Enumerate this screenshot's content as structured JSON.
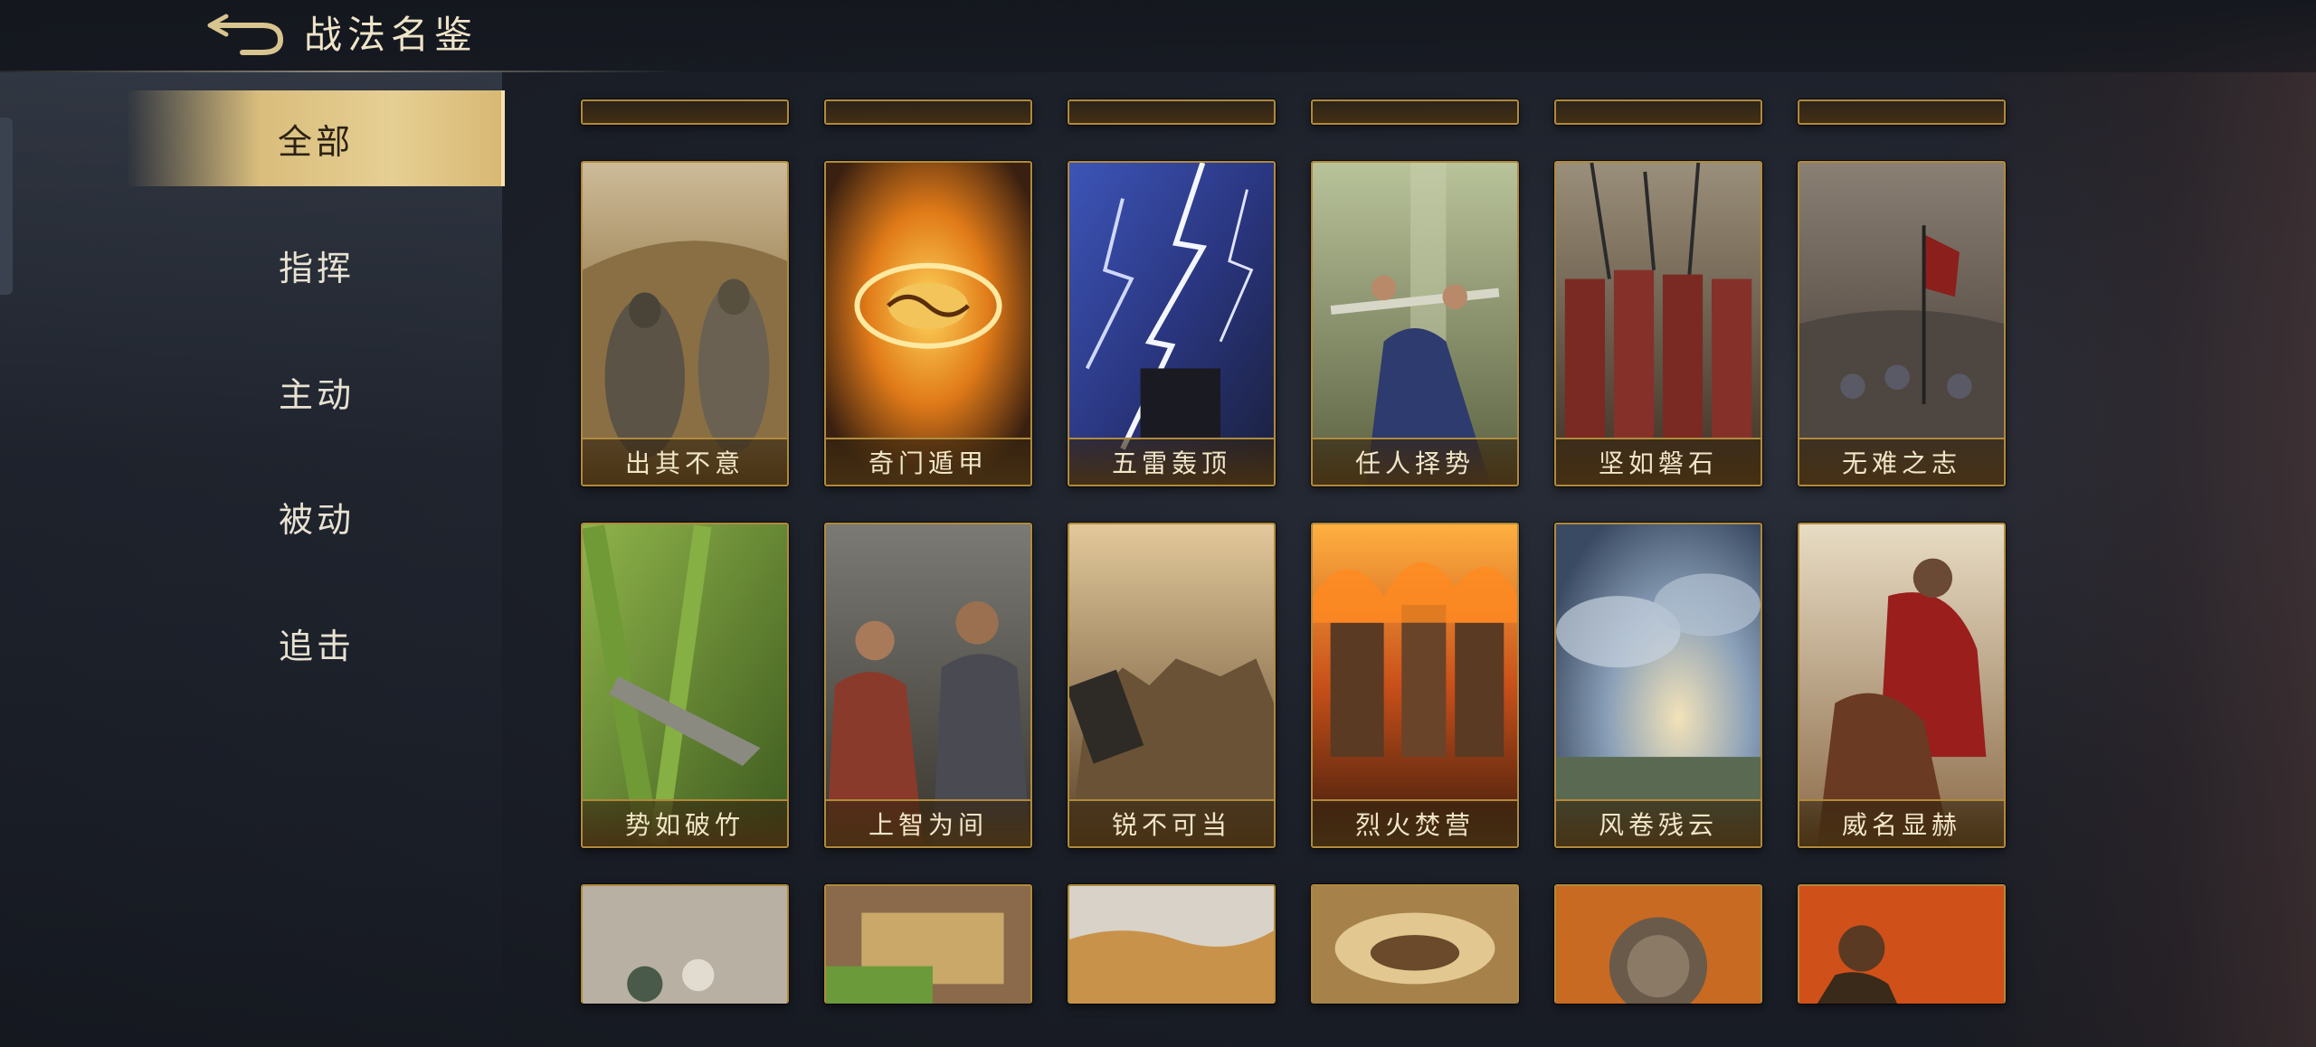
{
  "header": {
    "title": "战法名鉴"
  },
  "sidebar": {
    "items": [
      {
        "label": "全部",
        "active": true
      },
      {
        "label": "指挥",
        "active": false
      },
      {
        "label": "主动",
        "active": false
      },
      {
        "label": "被动",
        "active": false
      },
      {
        "label": "追击",
        "active": false
      }
    ]
  },
  "grid": {
    "row1": [
      {
        "label": "出其不意",
        "art": "stone-warriors"
      },
      {
        "label": "奇门遁甲",
        "art": "yin-yang-fire"
      },
      {
        "label": "五雷轰顶",
        "art": "lightning"
      },
      {
        "label": "任人择势",
        "art": "scholar-sword"
      },
      {
        "label": "坚如磐石",
        "art": "shield-wall"
      },
      {
        "label": "无难之志",
        "art": "army-march"
      }
    ],
    "row2": [
      {
        "label": "势如破竹",
        "art": "bamboo-blade"
      },
      {
        "label": "上智为间",
        "art": "two-officers"
      },
      {
        "label": "锐不可当",
        "art": "cavalry-charge"
      },
      {
        "label": "烈火焚营",
        "art": "burning-fort"
      },
      {
        "label": "风卷残云",
        "art": "storm-clouds"
      },
      {
        "label": "威名显赫",
        "art": "general-on-horse"
      }
    ]
  },
  "colors": {
    "gold": "#b08a3c",
    "active_tab": "#d9bd7c",
    "text": "#e8dcc0"
  }
}
